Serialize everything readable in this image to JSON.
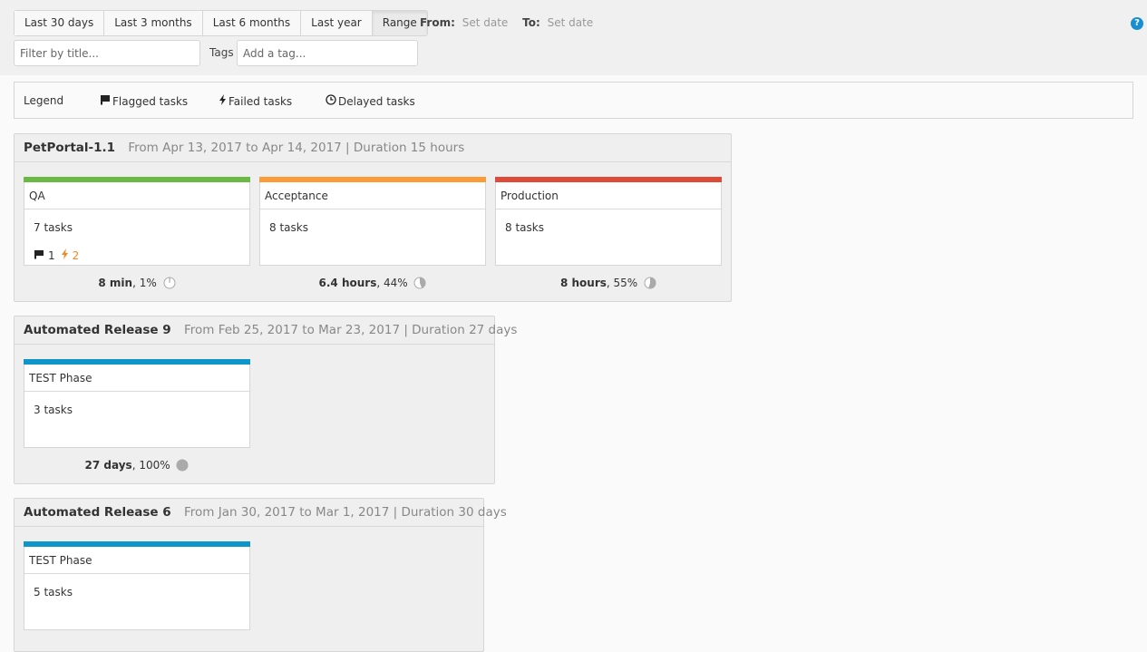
{
  "toolbar": {
    "range_buttons": [
      {
        "label": "Last 30 days",
        "active": false
      },
      {
        "label": "Last 3 months",
        "active": false
      },
      {
        "label": "Last 6 months",
        "active": false
      },
      {
        "label": "Last year",
        "active": false
      },
      {
        "label": "Range",
        "active": true
      }
    ],
    "from_label": "From:",
    "from_value": "Set date",
    "to_label": "To:",
    "to_value": "Set date",
    "help_icon": "?",
    "filter_placeholder": "Filter by title...",
    "tags_label": "Tags",
    "tags_placeholder": "Add a tag..."
  },
  "legend": {
    "title": "Legend",
    "items": [
      {
        "icon": "flag-icon",
        "label": "Flagged tasks"
      },
      {
        "icon": "bolt-icon",
        "label": "Failed tasks"
      },
      {
        "icon": "clock-icon",
        "label": "Delayed tasks"
      }
    ]
  },
  "colors": {
    "qa": "#6ab945",
    "acceptance": "#fb9c38",
    "production": "#de4b39",
    "test": "#0f95c9",
    "failed": "#f08a24",
    "help": "#1a8fd0"
  },
  "releases": [
    {
      "name": "PetPortal-1.1",
      "dates": "From Apr 13, 2017 to Apr 14, 2017 | Duration 15 hours",
      "phases": [
        {
          "title": "QA",
          "tasks": "7 tasks",
          "flagged": "1",
          "failed": "2",
          "duration": "8 min",
          "percent_label": "1%",
          "percent": 1,
          "color": "#6ab945"
        },
        {
          "title": "Acceptance",
          "tasks": "8 tasks",
          "duration": "6.4 hours",
          "percent_label": "44%",
          "percent": 44,
          "color": "#fb9c38"
        },
        {
          "title": "Production",
          "tasks": "8 tasks",
          "duration": "8 hours",
          "percent_label": "55%",
          "percent": 55,
          "color": "#de4b39"
        }
      ]
    },
    {
      "name": "Automated Release 9",
      "dates": "From Feb 25, 2017 to Mar 23, 2017 | Duration 27 days",
      "phases": [
        {
          "title": "TEST Phase",
          "tasks": "3 tasks",
          "duration": "27 days",
          "percent_label": "100%",
          "percent": 100,
          "color": "#0f95c9"
        }
      ]
    },
    {
      "name": "Automated Release 6",
      "dates": "From Jan 30, 2017 to Mar 1, 2017 | Duration 30 days",
      "phases": [
        {
          "title": "TEST Phase",
          "tasks": "5 tasks",
          "color": "#0f95c9"
        }
      ]
    }
  ]
}
